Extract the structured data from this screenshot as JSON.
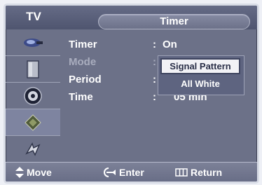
{
  "header": {
    "tv_label": "TV",
    "title": "Timer"
  },
  "sidebar": {
    "items": [
      {
        "icon": "picture-icon",
        "active": false
      },
      {
        "icon": "sound-icon",
        "active": false
      },
      {
        "icon": "channel-icon",
        "active": false
      },
      {
        "icon": "setup-icon",
        "active": true
      },
      {
        "icon": "input-icon",
        "active": false
      },
      {
        "icon": "digital-icon",
        "active": false
      }
    ]
  },
  "menu": {
    "rows": [
      {
        "label": "Timer",
        "colon": ":",
        "value": "On"
      },
      {
        "label": "Mode",
        "colon": ":",
        "value": ""
      },
      {
        "label": "Period",
        "colon": ":",
        "value": ""
      },
      {
        "label": "Time",
        "colon": ":",
        "value": "05 min"
      }
    ],
    "mode_options": [
      "Signal Pattern",
      "All White"
    ],
    "mode_selected": "Signal Pattern"
  },
  "footer": {
    "move": "Move",
    "enter": "Enter",
    "return": "Return"
  },
  "colors": {
    "panel": "#6c7188",
    "topbar": "#4f556f",
    "highlight": "#f2f2f6"
  }
}
